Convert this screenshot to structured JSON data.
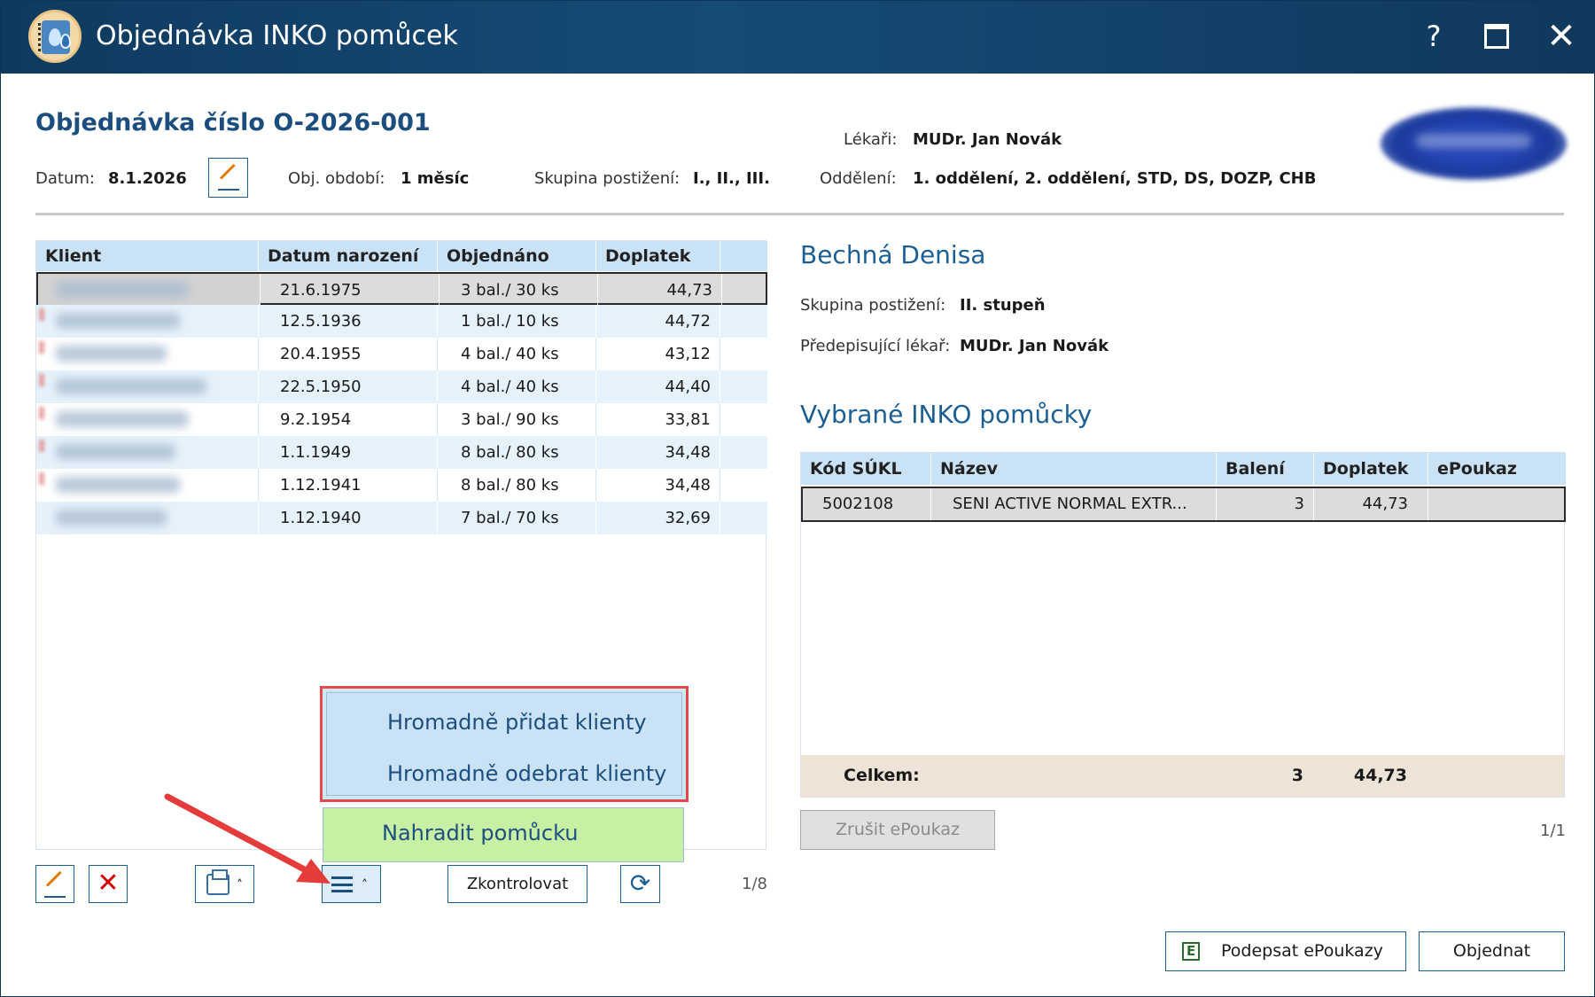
{
  "window": {
    "title": "Objednávka INKO pomůcek",
    "help_glyph": "?",
    "close_glyph": "✕"
  },
  "header": {
    "order_title": "Objednávka číslo O-2026-001",
    "date_label": "Datum:",
    "date_value": "8.1.2026",
    "period_label": "Obj. období:",
    "period_value": "1 měsíc",
    "group_label": "Skupina postižení:",
    "group_value": "I., II., III.",
    "doctors_label": "Lékaři:",
    "doctors_value": "MUDr. Jan Novák",
    "departments_label": "Oddělení:",
    "departments_value": "1. oddělení, 2. oddělení, STD, DS, DOZP, CHB"
  },
  "clients_table": {
    "columns": [
      "Klient",
      "Datum narození",
      "Objednáno",
      "Doplatek"
    ],
    "rows": [
      {
        "birth": "21.6.1975",
        "ordered": "3 bal./ 30 ks",
        "surcharge": "44,73"
      },
      {
        "birth": "12.5.1936",
        "ordered": "1 bal./ 10 ks",
        "surcharge": "44,72"
      },
      {
        "birth": "20.4.1955",
        "ordered": "4 bal./ 40 ks",
        "surcharge": "43,12"
      },
      {
        "birth": "22.5.1950",
        "ordered": "4 bal./ 40 ks",
        "surcharge": "44,40"
      },
      {
        "birth": "9.2.1954",
        "ordered": "3 bal./ 90 ks",
        "surcharge": "33,81"
      },
      {
        "birth": "1.1.1949",
        "ordered": "8 bal./ 80 ks",
        "surcharge": "34,48"
      },
      {
        "birth": "1.12.1941",
        "ordered": "8 bal./ 80 ks",
        "surcharge": "34,48"
      },
      {
        "birth": "1.12.1940",
        "ordered": "7 bal./ 70 ks",
        "surcharge": "32,69"
      }
    ],
    "pager": "1/8"
  },
  "toolbar": {
    "check_label": "Zkontrolovat",
    "refresh_glyph": "⟳",
    "delete_glyph": "✕",
    "caret_glyph": "˄"
  },
  "popup_menu": {
    "item_add": "Hromadně přidat klienty",
    "item_remove": "Hromadně odebrat klienty",
    "item_replace": "Nahradit pomůcku"
  },
  "client_detail": {
    "name": "Bechná Denisa",
    "group_label": "Skupina postižení:",
    "group_value": "II. stupeň",
    "doctor_label": "Předepisující lékař:",
    "doctor_value": "MUDr. Jan Novák"
  },
  "aids_section": {
    "title": "Vybrané INKO pomůcky",
    "columns": [
      "Kód SÚKL",
      "Název",
      "Balení",
      "Doplatek",
      "ePoukaz"
    ],
    "row": {
      "code": "5002108",
      "name": "SENI ACTIVE NORMAL EXTR...",
      "packs": "3",
      "surcharge": "44,73",
      "epoukaz": ""
    },
    "total_label": "Celkem:",
    "total_packs": "3",
    "total_surcharge": "44,73",
    "cancel_label": "Zrušit ePoukaz",
    "pager": "1/1"
  },
  "footer": {
    "sign_label": "Podepsat ePoukazy",
    "sign_icon_text": "E",
    "order_label": "Objednat"
  },
  "colors": {
    "titlebar": "#164b76",
    "accent_blue": "#1b5f94",
    "table_header": "#c9e2f5",
    "menu_highlight_border": "#e54848",
    "menu_green": "#c8f0a4",
    "total_row": "#ede3d6"
  },
  "icons": [
    "app-icon",
    "help-icon",
    "maximize-icon",
    "close-icon",
    "pencil-icon",
    "delete-icon",
    "printer-icon",
    "menu-icon",
    "refresh-icon",
    "epoukaz-icon"
  ]
}
